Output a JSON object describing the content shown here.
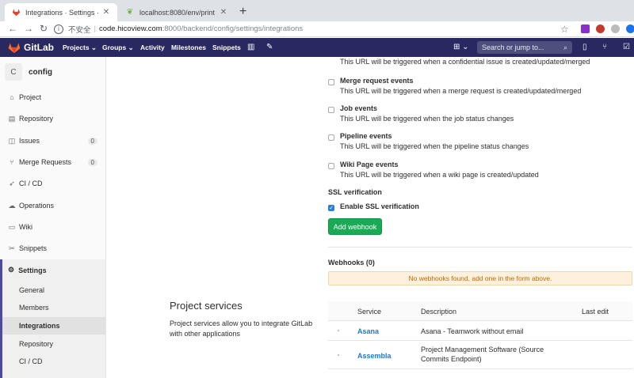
{
  "browser": {
    "tabs": [
      {
        "title": "Integrations · Settings · backe",
        "active": true
      },
      {
        "title": "localhost:8080/env/print",
        "active": false
      }
    ],
    "url_insecure_label": "不安全",
    "url_host": "code.hicoview.com",
    "url_path": ":8000/backend/config/settings/integrations"
  },
  "topnav": {
    "brand": "GitLab",
    "links": [
      "Projects",
      "Groups",
      "Activity",
      "Milestones",
      "Snippets"
    ],
    "search_placeholder": "Search or jump to..."
  },
  "sidebar": {
    "project_initial": "C",
    "project_name": "config",
    "items": [
      {
        "label": "Project",
        "icon": "home-icon"
      },
      {
        "label": "Repository",
        "icon": "book-icon"
      },
      {
        "label": "Issues",
        "icon": "issues-icon",
        "count": "0"
      },
      {
        "label": "Merge Requests",
        "icon": "merge-request-icon",
        "count": "0"
      },
      {
        "label": "CI / CD",
        "icon": "rocket-icon"
      },
      {
        "label": "Operations",
        "icon": "cloud-gear-icon"
      },
      {
        "label": "Wiki",
        "icon": "wiki-icon"
      },
      {
        "label": "Snippets",
        "icon": "scissors-icon"
      }
    ],
    "settings": {
      "label": "Settings",
      "sub_items": [
        "General",
        "Members",
        "Integrations",
        "Repository",
        "CI / CD"
      ],
      "active": "Integrations"
    }
  },
  "hooks": [
    {
      "title": "",
      "desc": "This URL will be triggered when a confidential issue is created/updated/merged"
    },
    {
      "title": "Merge request events",
      "desc": "This URL will be triggered when a merge request is created/updated/merged"
    },
    {
      "title": "Job events",
      "desc": "This URL will be triggered when the job status changes"
    },
    {
      "title": "Pipeline events",
      "desc": "This URL will be triggered when the pipeline status changes"
    },
    {
      "title": "Wiki Page events",
      "desc": "This URL will be triggered when a wiki page is created/updated"
    }
  ],
  "ssl": {
    "section_label": "SSL verification",
    "checkbox_label": "Enable SSL verification",
    "checked": true
  },
  "add_webhook_label": "Add webhook",
  "webhooks": {
    "title": "Webhooks (0)",
    "empty_message": "No webhooks found, add one in the form above."
  },
  "project_services": {
    "title": "Project services",
    "description": "Project services allow you to integrate GitLab with other applications",
    "columns": [
      "Service",
      "Description",
      "Last edit"
    ],
    "rows": [
      {
        "name": "Asana",
        "description": "Asana - Teamwork without email"
      },
      {
        "name": "Assembla",
        "description": "Project Management Software (Source Commits Endpoint)"
      }
    ]
  },
  "colors": {
    "nav_bg": "#292961",
    "accent": "#4b4ba3",
    "button_green": "#1aaa55",
    "link_blue": "#1f78d1",
    "warning_bg": "#fdf1dd",
    "warning_text": "#c26700"
  }
}
